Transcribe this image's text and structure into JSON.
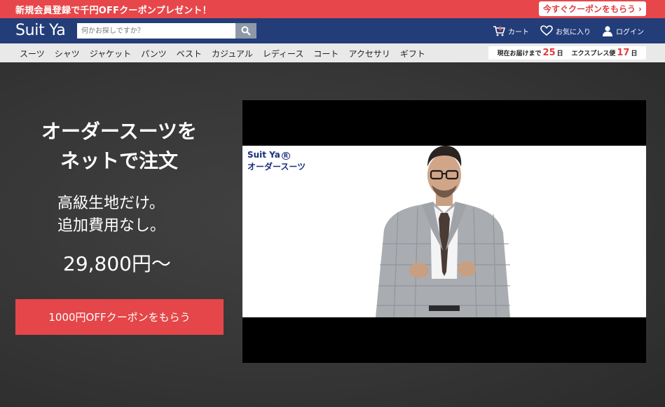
{
  "promo": {
    "text": "新規会員登録で千円OFFクーポンプレゼント！",
    "button_label": "今すぐクーポンをもらう",
    "bg_color": "#e7474a"
  },
  "header": {
    "logo": "Suit Ya",
    "search_placeholder": "何かお探しですか？",
    "cart_label": "カート",
    "favorites_label": "お気に入り",
    "login_label": "ログイン",
    "bg_color": "#233d79"
  },
  "nav": {
    "categories": [
      "スーツ",
      "シャツ",
      "ジャケット",
      "パンツ",
      "ベスト",
      "カジュアル",
      "レディース",
      "コート",
      "アクセサリ",
      "ギフト"
    ],
    "delivery": {
      "current_label": "現在お届けまで",
      "current_days": "25",
      "day_unit": "日",
      "express_label": "エクスプレス便",
      "express_days": "17"
    }
  },
  "hero": {
    "title_line1": "オーダースーツを",
    "title_line2": "ネットで注文",
    "sub_line1": "高級生地だけ。",
    "sub_line2": "追加費用なし。",
    "price": "29,800円～",
    "cta_label": "1000円OFFクーポンをもらう",
    "accent_color": "#e44649"
  },
  "video": {
    "brand": "Suit Ya",
    "brand_mark": "R",
    "caption": "オーダースーツ"
  }
}
